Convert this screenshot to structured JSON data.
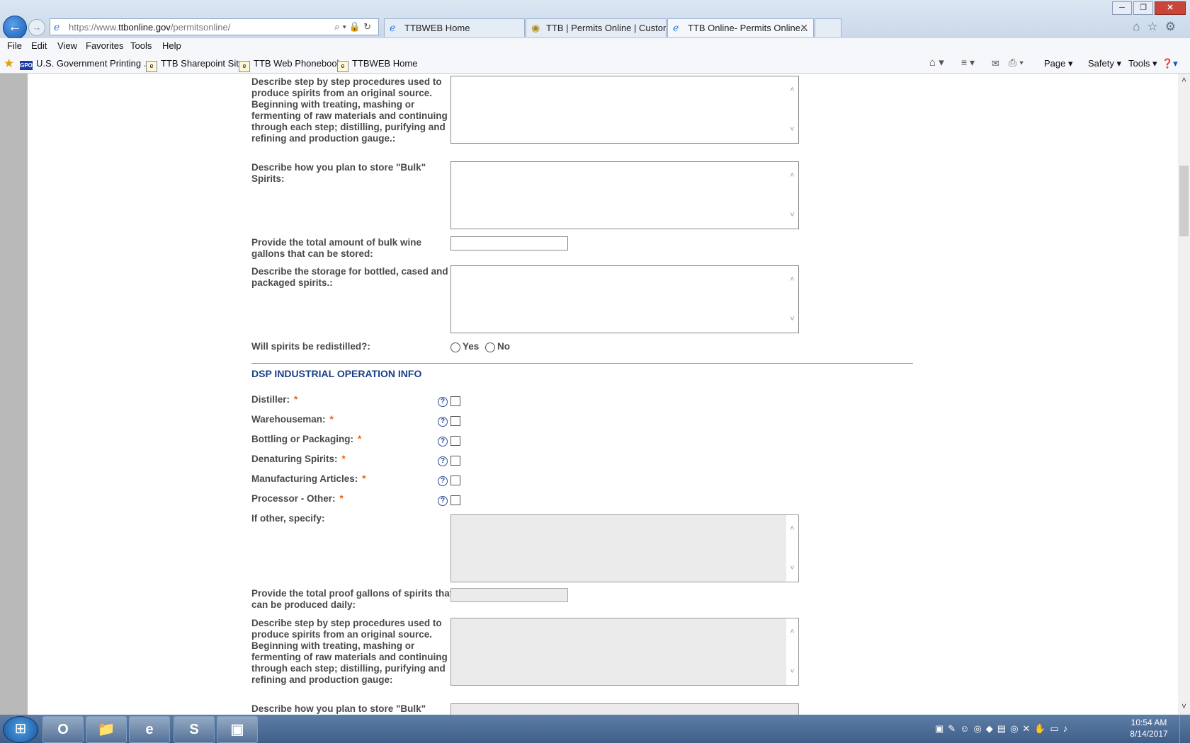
{
  "browser": {
    "url_prefix": "https://www.",
    "url_domain": "ttbonline.gov",
    "url_path": "/permitsonline/",
    "tabs": [
      {
        "label": "TTBWEB Home",
        "active": false
      },
      {
        "label": "TTB | Permits Online | Custom...",
        "active": false
      },
      {
        "label": "TTB Online- Permits Online...",
        "active": true
      }
    ],
    "menu": [
      "File",
      "Edit",
      "View",
      "Favorites",
      "Tools",
      "Help"
    ],
    "favorites": [
      "U.S. Government Printing ...",
      "TTB Sharepoint Site",
      "TTB Web Phonebook",
      "TTBWEB Home"
    ],
    "gpo_badge": "GPO",
    "commands": {
      "page": "Page",
      "safety": "Safety",
      "tools": "Tools"
    }
  },
  "form": {
    "fields_top": {
      "procedures_label": "Describe step by step procedures used to produce spirits from an original source. Beginning with treating, mashing or fermenting of raw materials and continuing through each step; distilling, purifying and refining and production gauge.:",
      "bulk_storage_label": "Describe how you plan to store \"Bulk\" Spirits:",
      "bulk_wine_label": "Provide the total amount of bulk wine gallons that can be stored:",
      "bottled_storage_label": "Describe the storage for bottled, cased and packaged spirits.:",
      "redistilled_label": "Will spirits be redistilled?:",
      "yes_label": "Yes",
      "no_label": "No"
    },
    "section_title": "DSP INDUSTRIAL OPERATION INFO",
    "operations": [
      {
        "label": "Distiller:",
        "required": "*"
      },
      {
        "label": "Warehouseman:",
        "required": "*"
      },
      {
        "label": "Bottling or Packaging:",
        "required": "*"
      },
      {
        "label": "Denaturing Spirits:",
        "required": "*"
      },
      {
        "label": "Manufacturing Articles:",
        "required": "*"
      },
      {
        "label": "Processor - Other:",
        "required": "*"
      }
    ],
    "help_glyph": "?",
    "fields_bottom": {
      "other_specify_label": "If other, specify:",
      "proof_gallons_label": "Provide the total proof gallons of spirits that can be produced daily:",
      "procedures_label": "Describe step by step procedures used to produce spirits from an original source. Beginning with treating, mashing or fermenting of raw materials and continuing through each step; distilling, purifying and refining and production gauge:",
      "bulk_storage_label": "Describe how you plan to store \"Bulk\""
    }
  },
  "taskbar": {
    "time": "10:54 AM",
    "date": "8/14/2017"
  }
}
